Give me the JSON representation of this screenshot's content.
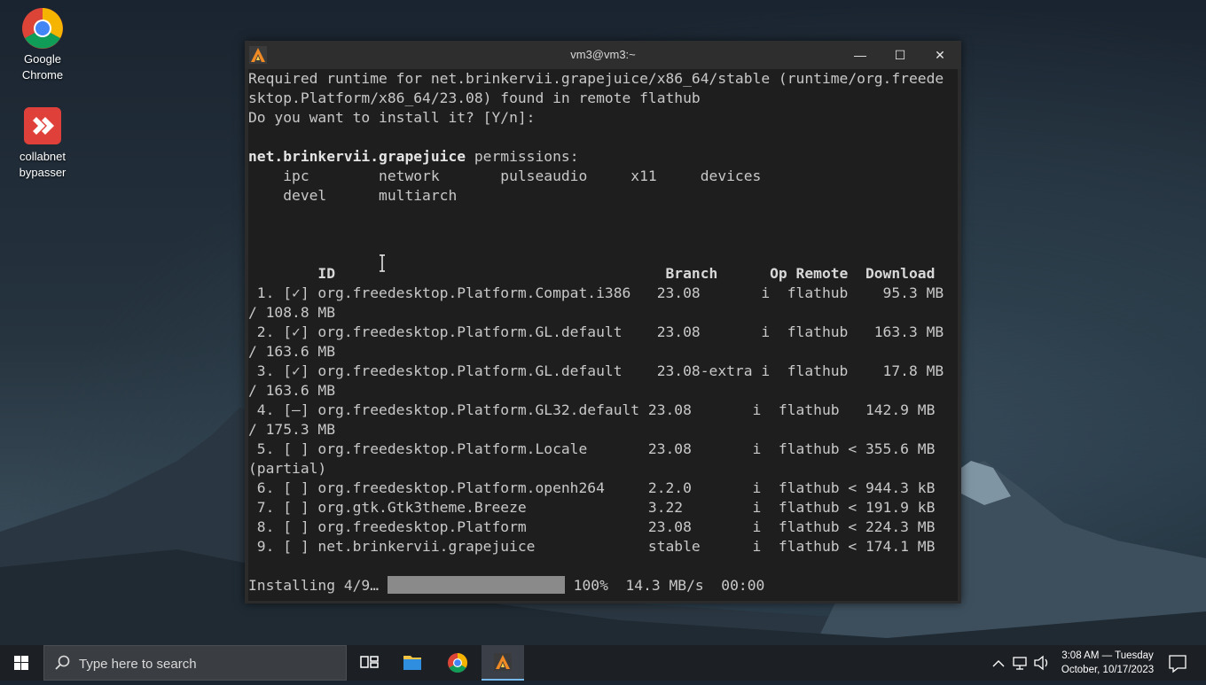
{
  "desktop": {
    "icons": [
      {
        "label_line1": "Google",
        "label_line2": "Chrome",
        "icon": "chrome-icon"
      },
      {
        "label_line1": "collabnet",
        "label_line2": "bypasser",
        "icon": "anydesk-icon"
      }
    ]
  },
  "terminal": {
    "title": "vm3@vm3:~",
    "lines": {
      "l1": "Required runtime for net.brinkervii.grapejuice/x86_64/stable (runtime/org.freede",
      "l2": "sktop.Platform/x86_64/23.08) found in remote flathub",
      "l3": "Do you want to install it? [Y/n]:",
      "perm_app": "net.brinkervii.grapejuice",
      "perm_suffix": " permissions:",
      "perm_row1": "    ipc        network       pulseaudio     x11     devices",
      "perm_row2": "    devel      multiarch",
      "table_header": "        ID                                      Branch      Op Remote  Download",
      "rows": [
        " 1. [✓] org.freedesktop.Platform.Compat.i386   23.08       i  flathub    95.3 MB",
        "/ 108.8 MB",
        " 2. [✓] org.freedesktop.Platform.GL.default    23.08       i  flathub   163.3 MB",
        "/ 163.6 MB",
        " 3. [✓] org.freedesktop.Platform.GL.default    23.08-extra i  flathub    17.8 MB",
        "/ 163.6 MB",
        " 4. [–] org.freedesktop.Platform.GL32.default 23.08       i  flathub   142.9 MB",
        "/ 175.3 MB",
        " 5. [ ] org.freedesktop.Platform.Locale       23.08       i  flathub < 355.6 MB",
        "(partial)",
        " 6. [ ] org.freedesktop.Platform.openh264     2.2.0       i  flathub < 944.3 kB",
        " 7. [ ] org.gtk.Gtk3theme.Breeze              3.22        i  flathub < 191.9 kB",
        " 8. [ ] org.freedesktop.Platform              23.08       i  flathub < 224.3 MB",
        " 9. [ ] net.brinkervii.grapejuice             stable      i  flathub < 174.1 MB"
      ],
      "install_label": "Installing 4/9…",
      "install_stats": " 100%  14.3 MB/s  00:00",
      "progress_fraction": 1.0
    },
    "controls": {
      "minimize": "—",
      "maximize": "☐",
      "close": "✕"
    }
  },
  "taskbar": {
    "search_placeholder": "Type here to search",
    "clock_time": "3:08 AM — Tuesday",
    "clock_date": "October, 10/17/2023"
  },
  "colors": {
    "taskbar_bg": "#1c1f23",
    "terminal_bg": "#1e1e1e",
    "active_underline": "#76b9ed"
  }
}
